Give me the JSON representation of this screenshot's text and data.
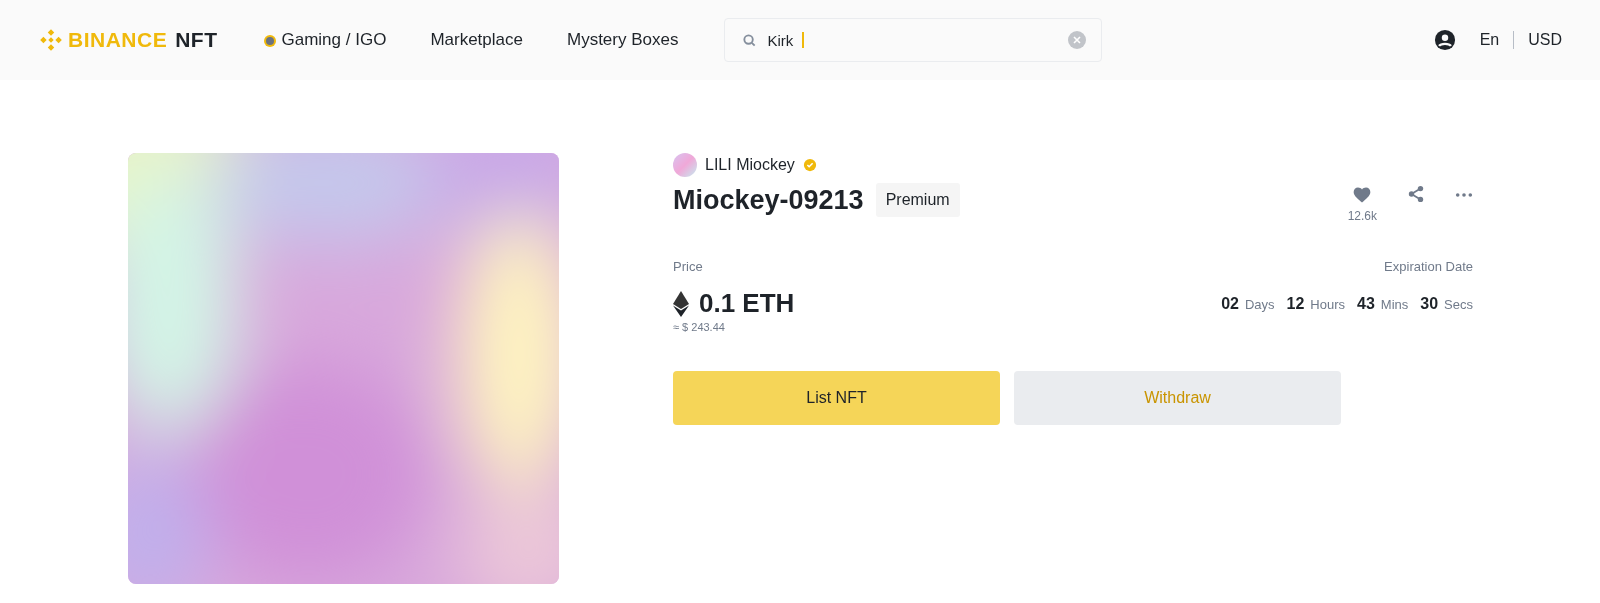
{
  "header": {
    "logo": {
      "brand": "BINANCE",
      "product": "NFT"
    },
    "nav": [
      {
        "label": "Gaming / IGO",
        "kind": "icon"
      },
      {
        "label": "Marketplace",
        "kind": "plain"
      },
      {
        "label": "Mystery Boxes",
        "kind": "plain"
      }
    ],
    "search": {
      "value": "Kirk"
    },
    "language": "En",
    "currency": "USD"
  },
  "item": {
    "creator": {
      "name": "LILI Miockey",
      "verified": true
    },
    "title": "Miockey-09213",
    "badge": "Premium",
    "likes": "12.6k",
    "price": {
      "label": "Price",
      "value": "0.1 ETH",
      "fiat": "≈ $ 243.44"
    },
    "expiration": {
      "label": "Expiration Date",
      "countdown": [
        {
          "value": "02",
          "unit": "Days"
        },
        {
          "value": "12",
          "unit": "Hours"
        },
        {
          "value": "43",
          "unit": "Mins"
        },
        {
          "value": "30",
          "unit": "Secs"
        }
      ]
    },
    "buttons": [
      {
        "label": "List NFT",
        "kind": "primary"
      },
      {
        "label": "Withdraw",
        "kind": "secondary"
      }
    ]
  }
}
